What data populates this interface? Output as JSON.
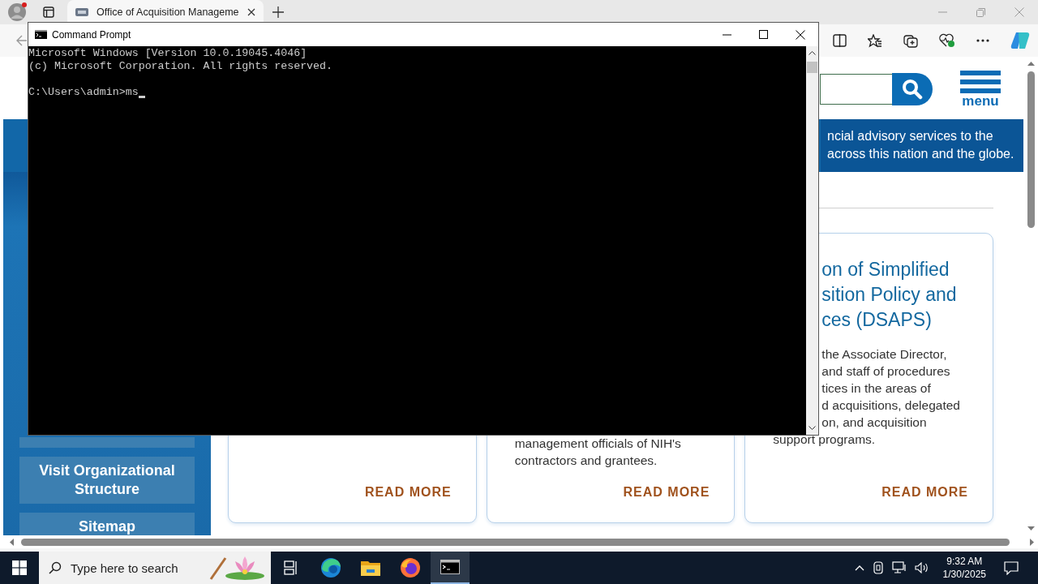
{
  "browser": {
    "tabs": [
      {
        "title": "Office of Acquisition Manageme",
        "selected": true
      }
    ]
  },
  "page": {
    "header": {
      "menu_label": "menu"
    },
    "banner": {
      "lines": [
        "ncial advisory services to the",
        "across this nation and the globe."
      ]
    },
    "sidebar": {
      "buttons": [
        {
          "kind": "covered"
        },
        {
          "kind": "label",
          "label": "Visit Organizational Structure"
        },
        {
          "kind": "label",
          "label": "Sitemap"
        }
      ]
    },
    "cards": [
      {
        "action": "READ MORE"
      },
      {
        "body_lines": [
          {
            "text": "management officials of NIH's",
            "clipped": false
          },
          {
            "text": "contractors and grantees.",
            "clipped": false
          }
        ],
        "action": "READ MORE"
      },
      {
        "title_lines": [
          {
            "text": "on of Simplified",
            "clipped": true
          },
          {
            "text": "sition Policy and",
            "clipped": true
          },
          {
            "text": "ces (DSAPS)",
            "clipped": true
          }
        ],
        "body_lines": [
          {
            "text": "the Associate Director,",
            "clipped": true
          },
          {
            "text": "and staff of procedures",
            "clipped": true
          },
          {
            "text": "tices in the areas of",
            "clipped": true
          },
          {
            "text": "d acquisitions, delegated",
            "clipped": true
          },
          {
            "text": "on, and acquisition",
            "clipped": true
          },
          {
            "text": "support programs.",
            "clipped": false
          }
        ],
        "action": "READ MORE"
      }
    ]
  },
  "cmd": {
    "title": "Command Prompt",
    "output": [
      "Microsoft Windows [Version 10.0.19045.4046]",
      "(c) Microsoft Corporation. All rights reserved."
    ],
    "prompt": "C:\\Users\\admin>ms"
  },
  "taskbar": {
    "search_placeholder": "Type here to search",
    "apps": [
      {
        "kind": "task-view",
        "selected": false
      },
      {
        "kind": "edge",
        "selected": false
      },
      {
        "kind": "explorer",
        "selected": false
      },
      {
        "kind": "firefox",
        "selected": false
      },
      {
        "kind": "cmd",
        "selected": true
      }
    ],
    "time": "9:32 AM",
    "date": "1/30/2025"
  }
}
